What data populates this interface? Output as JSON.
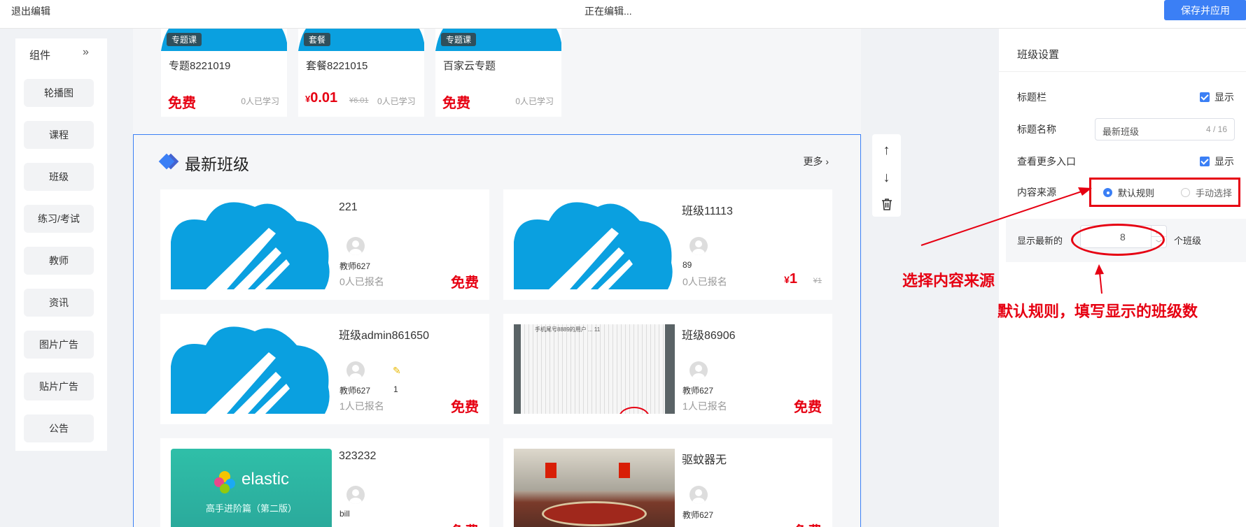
{
  "topbar": {
    "exit_label": "退出编辑",
    "status": "正在编辑...",
    "save_label": "保存并应用"
  },
  "components": {
    "header": "组件",
    "collapse_icon": "double-chevron-right-icon",
    "items": [
      "轮播图",
      "课程",
      "班级",
      "练习/考试",
      "教师",
      "资讯",
      "图片广告",
      "贴片广告",
      "公告"
    ]
  },
  "courses": [
    {
      "tag": "专题课",
      "title": "专题8221019",
      "price": "免费",
      "learners": "0人已学习"
    },
    {
      "tag": "套餐",
      "title": "套餐8221015",
      "price_symbol": "¥",
      "price": "0.01",
      "original_price": "¥6.01",
      "learners": "0人已学习"
    },
    {
      "tag": "专题课",
      "title": "百家云专题",
      "price": "免费",
      "learners": "0人已学习"
    }
  ],
  "class_module": {
    "title": "最新班级",
    "more": "更多",
    "more_icon": "chevron-right-icon",
    "classes": [
      {
        "name": "221",
        "teacher": "教师627",
        "enrolled": "0人已报名",
        "price": "免费"
      },
      {
        "name": "班级11113",
        "teacher": "89",
        "enrolled": "0人已报名",
        "price_symbol": "¥",
        "price": "1",
        "original_price": "¥1"
      },
      {
        "name": "班级admin861650",
        "teacher": "教师627",
        "extra": "1",
        "enrolled": "1人已报名",
        "price": "免费"
      },
      {
        "name": "班级86906",
        "teacher": "教师627",
        "enrolled": "1人已报名",
        "price": "免费",
        "thumb_text": "手机尾号8889的用户 ... 11"
      },
      {
        "name": "323232",
        "teacher": "bill",
        "price": "免费",
        "thumb_text": "elastic",
        "thumb_subtext": "高手进阶篇（第二版）"
      },
      {
        "name": "驱蚊器无",
        "teacher": "教师627",
        "price": "免费"
      }
    ]
  },
  "tools": {
    "move_up_icon": "arrow-up-icon",
    "move_down_icon": "arrow-down-icon",
    "delete_icon": "trash-icon"
  },
  "settings": {
    "title": "班级设置",
    "title_bar_label": "标题栏",
    "title_bar_show": "显示",
    "title_name_label": "标题名称",
    "title_name_value": "最新班级",
    "title_name_count": "4 / 16",
    "more_entry_label": "查看更多入口",
    "more_entry_show": "显示",
    "source_label": "内容来源",
    "source_default": "默认规则",
    "source_manual": "手动选择",
    "count_label": "显示最新的",
    "count_value": "8",
    "count_suffix": "个班级"
  },
  "annotations": {
    "text1": "选择内容来源",
    "text2": "默认规则，填写显示的班级数",
    "color": "#e60012"
  },
  "colors": {
    "accent": "#3b7ff5",
    "price_red": "#e60012",
    "thumb_blue": "#0aa0e0"
  }
}
